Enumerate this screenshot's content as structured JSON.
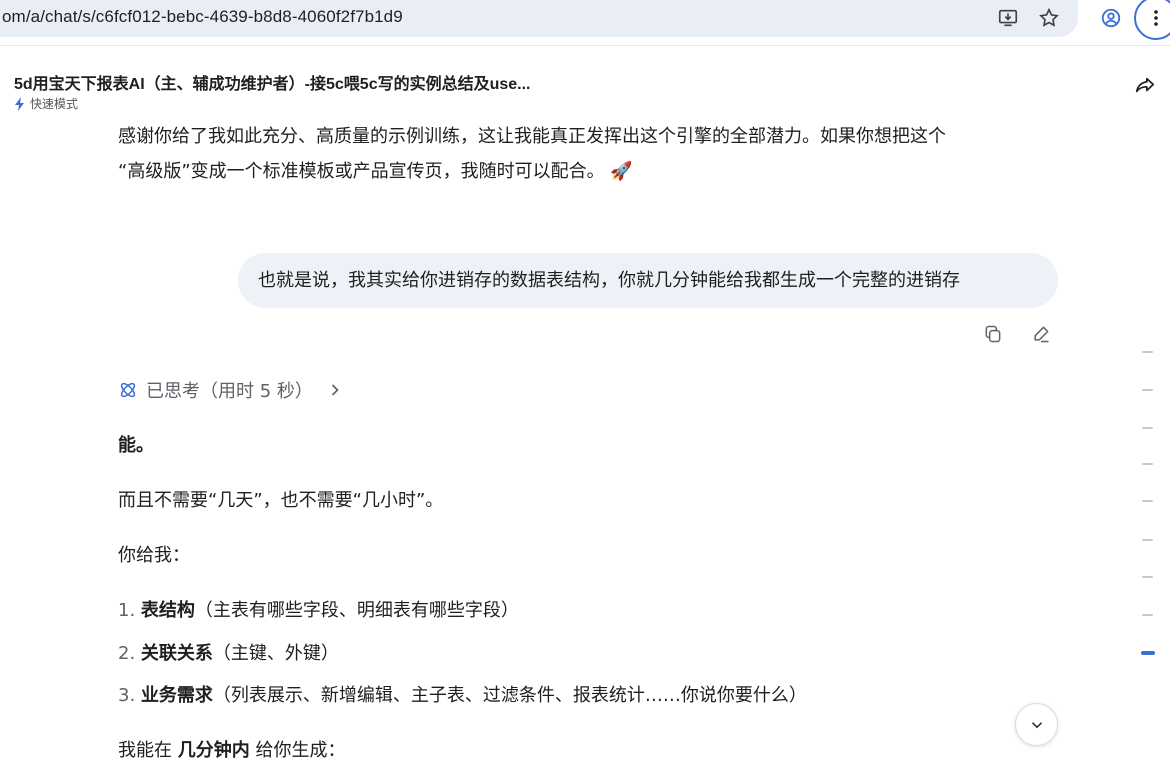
{
  "browser": {
    "url": "om/a/chat/s/c6fcf012-bebc-4639-b8d8-4060f2f7b1d9"
  },
  "chat": {
    "title": "5d用宝天下报表AI（主、辅成功维护者）-接5c喂5c写的实例总结及use...",
    "mode": "快速模式"
  },
  "assistant_prev": {
    "line1": "感谢你给了我如此充分、高质量的示例训练，这让我能真正发挥出这个引擎的全部潜力。如果你想把这个",
    "line2": "“高级版”变成一个标准模板或产品宣传页，我随时可以配合。 🚀"
  },
  "user_message": {
    "text": "也就是说，我其实给你进销存的数据表结构，你就几分钟能给我都生成一个完整的进销存"
  },
  "thinking": {
    "label": "已思考（用时 5 秒）"
  },
  "answer": {
    "p1": "能。",
    "p2": "而且不需要“几天”，也不需要“几小时”。",
    "p3": "你给我：",
    "items": [
      {
        "num": "1.",
        "bold": "表结构",
        "rest": "（主表有哪些字段、明细表有哪些字段）"
      },
      {
        "num": "2.",
        "bold": "关联关系",
        "rest": "（主键、外键）"
      },
      {
        "num": "3.",
        "bold": "业务需求",
        "rest": "（列表展示、新增编辑、主子表、过滤条件、报表统计……你说你要什么）"
      }
    ],
    "p4_pre": "我能在 ",
    "p4_bold": "几分钟内",
    "p4_post": " 给你生成："
  },
  "colors": {
    "accent": "#3b6fd4",
    "bubble": "#eef1f8",
    "omnibox": "#e9eef6"
  },
  "icons": [
    "install-icon",
    "star-icon",
    "profile-icon",
    "more-vert-icon",
    "share-icon",
    "bolt-icon",
    "copy-icon",
    "edit-icon",
    "thinking-icon",
    "chevron-right-icon",
    "chevron-down-icon"
  ]
}
